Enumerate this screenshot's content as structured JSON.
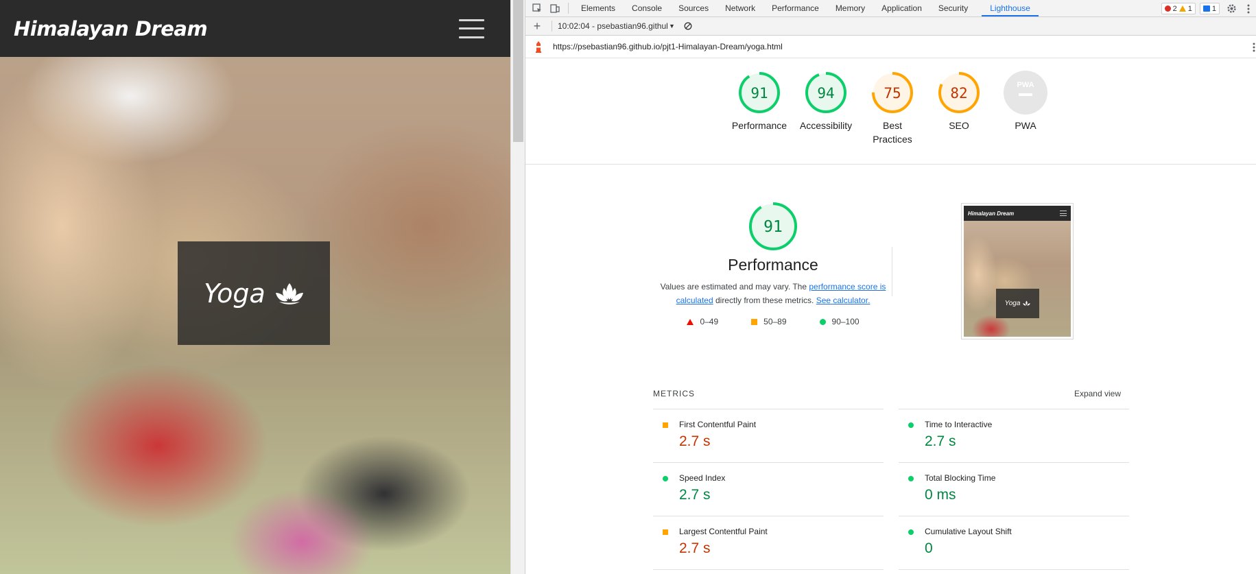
{
  "site": {
    "brand": "Himalayan Dream",
    "hero_title": "Yoga"
  },
  "devtools": {
    "tabs": [
      "Elements",
      "Console",
      "Sources",
      "Network",
      "Performance",
      "Memory",
      "Application",
      "Security",
      "Lighthouse"
    ],
    "active_tab": "Lighthouse",
    "badges": {
      "errors": "2",
      "warnings": "1",
      "messages": "1"
    },
    "toolbar": {
      "report_select": "10:02:04 - psebastian96.github"
    },
    "url": "https://psebastian96.github.io/pjt1-Himalayan-Dream/yoga.html"
  },
  "lighthouse": {
    "gauges": [
      {
        "label": "Performance",
        "score": "91",
        "fraction": 0.91,
        "color": "#0cce6b",
        "bg": "#e8f8ee",
        "text": "#018642"
      },
      {
        "label": "Accessibility",
        "score": "94",
        "fraction": 0.94,
        "color": "#0cce6b",
        "bg": "#e8f8ee",
        "text": "#018642"
      },
      {
        "label": "Best Practices",
        "score": "75",
        "fraction": 0.75,
        "color": "#ffa400",
        "bg": "#fff5e6",
        "text": "#c33300"
      },
      {
        "label": "SEO",
        "score": "82",
        "fraction": 0.82,
        "color": "#ffa400",
        "bg": "#fff5e6",
        "text": "#c33300"
      },
      {
        "label": "PWA",
        "score": "",
        "fraction": 0,
        "color": "#cccccc",
        "bg": "#e6e6e6",
        "text": "#ffffff"
      }
    ],
    "pwa_badge": "PWA",
    "perf": {
      "score": "91",
      "fraction": 0.91,
      "title": "Performance",
      "desc_pre": "Values are estimated and may vary. The ",
      "desc_link1": "performance score is calculated",
      "desc_mid": " directly from these metrics. ",
      "desc_link2": "See calculator."
    },
    "legend": {
      "fail": "0–49",
      "average": "50–89",
      "pass": "90–100"
    },
    "thumb": {
      "brand": "Himalayan Dream",
      "hero": "Yoga"
    },
    "metrics_title": "METRICS",
    "expand_view": "Expand view",
    "metrics": [
      {
        "label": "First Contentful Paint",
        "value": "2.7 s",
        "rating": "average"
      },
      {
        "label": "Time to Interactive",
        "value": "2.7 s",
        "rating": "pass"
      },
      {
        "label": "Speed Index",
        "value": "2.7 s",
        "rating": "pass"
      },
      {
        "label": "Total Blocking Time",
        "value": "0 ms",
        "rating": "pass"
      },
      {
        "label": "Largest Contentful Paint",
        "value": "2.7 s",
        "rating": "average"
      },
      {
        "label": "Cumulative Layout Shift",
        "value": "0",
        "rating": "pass"
      }
    ]
  }
}
